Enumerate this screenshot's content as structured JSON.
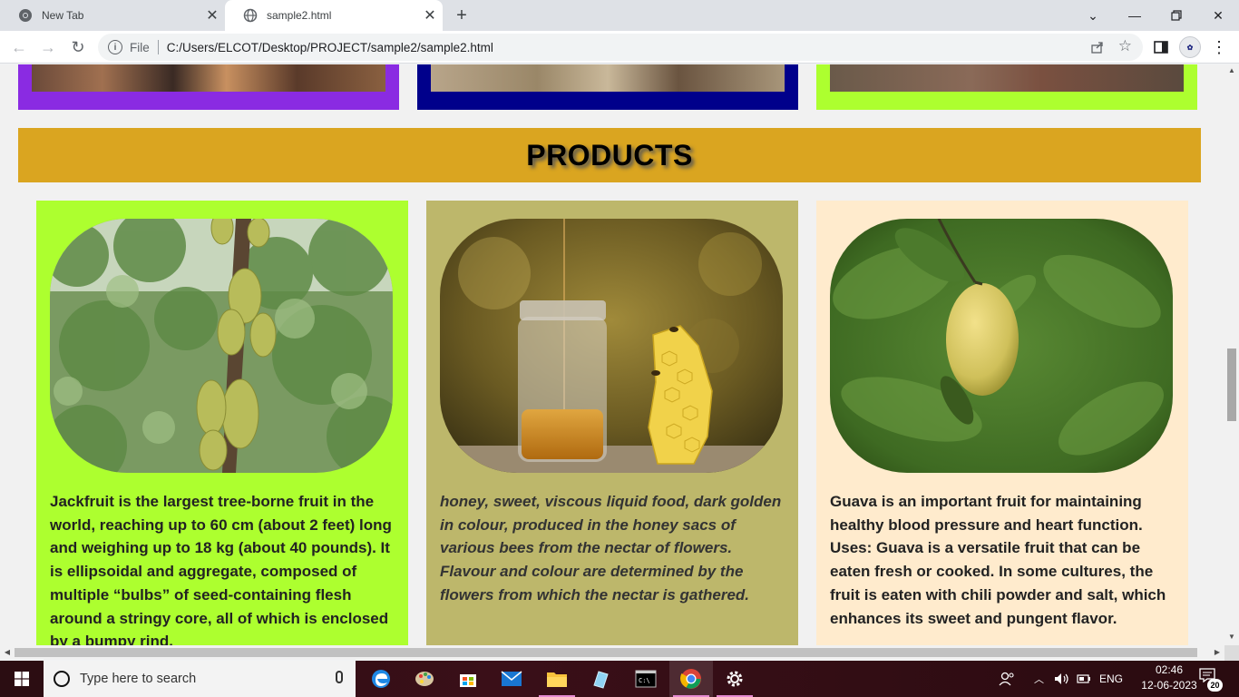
{
  "browser": {
    "tabs": [
      {
        "title": "New Tab",
        "active": false
      },
      {
        "title": "sample2.html",
        "active": true
      }
    ],
    "omnibox": {
      "scheme_label": "File",
      "url": "C:/Users/ELCOT/Desktop/PROJECT/sample2/sample2.html"
    }
  },
  "page": {
    "top_cards": [
      {
        "border_color": "#8a2be2"
      },
      {
        "border_color": "#00008b"
      },
      {
        "border_color": "#adff2f"
      }
    ],
    "products_heading": "PRODUCTS",
    "products_heading_bg": "#daa520",
    "products": [
      {
        "image": "jackfruit-tree-photo",
        "bg_color": "#adff2f",
        "italic": false,
        "description": "Jackfruit is the largest tree-borne fruit in the world, reaching up to 60 cm (about 2 feet) long and weighing up to 18 kg (about 40 pounds). It is ellipsoidal and aggregate, composed of multiple “bulbs” of seed-containing flesh around a stringy core, all of which is enclosed by a bumpy rind."
      },
      {
        "image": "honey-jar-and-honeycomb-photo",
        "bg_color": "#bdb76b",
        "italic": true,
        "description": "honey, sweet, viscous liquid food, dark golden in colour, produced in the honey sacs of various bees from the nectar of flowers. Flavour and colour are determined by the flowers from which the nectar is gathered."
      },
      {
        "image": "guava-on-branch-photo",
        "bg_color": "#ffebcd",
        "italic": false,
        "description": "Guava is an important fruit for maintaining healthy blood pressure and heart function. Uses: Guava is a versatile fruit that can be eaten fresh or cooked. In some cultures, the fruit is eaten with chili powder and salt, which enhances its sweet and pungent flavor."
      }
    ]
  },
  "taskbar": {
    "search_placeholder": "Type here to search",
    "language": "ENG",
    "time": "02:46",
    "date": "12-06-2023",
    "notification_count": "20"
  }
}
